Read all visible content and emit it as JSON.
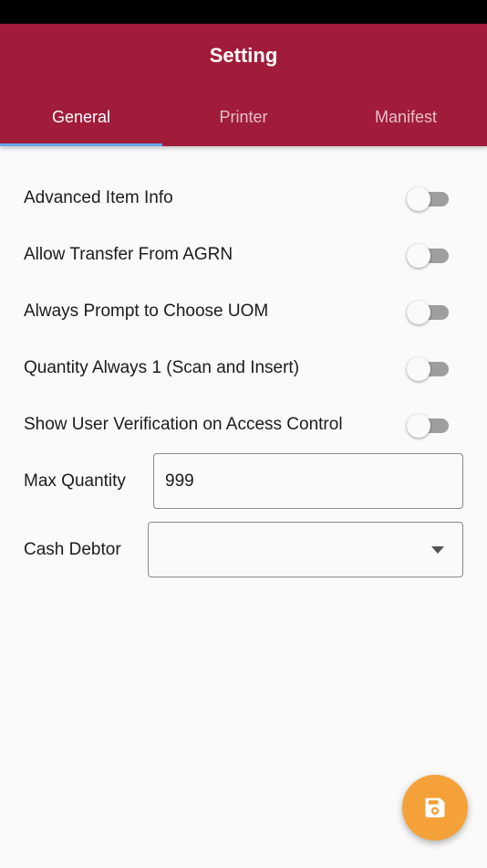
{
  "app_bar": {
    "title": "Setting",
    "background_color": "#a11c3a"
  },
  "tabs": [
    {
      "label": "General",
      "active": true
    },
    {
      "label": "Printer",
      "active": false
    },
    {
      "label": "Manifest",
      "active": false
    }
  ],
  "settings": [
    {
      "label": "Advanced Item Info",
      "enabled": false
    },
    {
      "label": "Allow Transfer From AGRN",
      "enabled": false
    },
    {
      "label": "Always Prompt to Choose UOM",
      "enabled": false
    },
    {
      "label": "Quantity Always 1 (Scan and Insert)",
      "enabled": false
    },
    {
      "label": "Show User Verification on Access Control",
      "enabled": false
    }
  ],
  "max_quantity": {
    "label": "Max Quantity",
    "value": "999"
  },
  "cash_debtor": {
    "label": "Cash Debtor",
    "value": ""
  },
  "fab": {
    "icon": "save-icon",
    "color": "#f5a13a"
  },
  "colors": {
    "accent_indicator": "#64a7f0",
    "toggle_off_track": "#9e9e9e"
  }
}
